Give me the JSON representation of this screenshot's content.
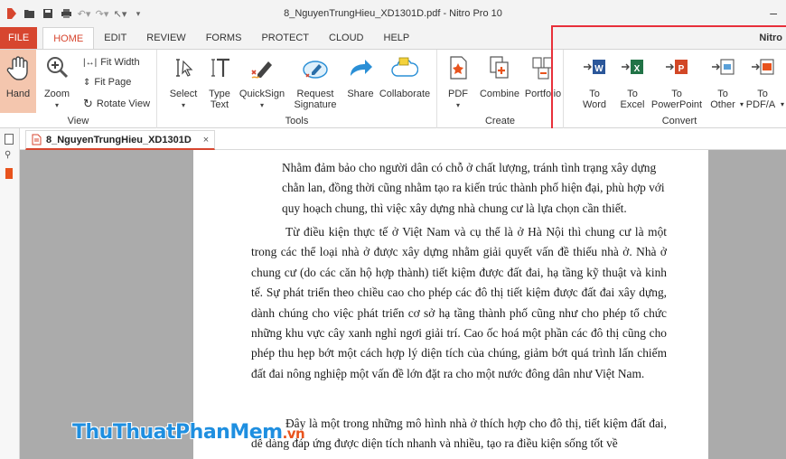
{
  "window": {
    "title": "8_NguyenTrungHieu_XD1301D.pdf - Nitro Pro 10",
    "minimize": "–"
  },
  "tabs": [
    "FILE",
    "HOME",
    "EDIT",
    "REVIEW",
    "FORMS",
    "PROTECT",
    "CLOUD",
    "HELP"
  ],
  "active_tab": "HOME",
  "brand_right": "Nitro",
  "ribbon": {
    "view": {
      "label": "View",
      "hand": "Hand",
      "zoom": "Zoom",
      "fit_width": "Fit Width",
      "fit_page": "Fit Page",
      "rotate_view": "Rotate View"
    },
    "tools": {
      "label": "Tools",
      "select": "Select",
      "type_text_1": "Type",
      "type_text_2": "Text",
      "quicksign": "QuickSign",
      "request_1": "Request",
      "request_2": "Signature",
      "share": "Share",
      "collaborate": "Collaborate"
    },
    "create": {
      "label": "Create",
      "pdf": "PDF",
      "combine": "Combine",
      "portfolio": "Portfolio"
    },
    "convert": {
      "label": "Convert",
      "to_word_1": "To",
      "to_word_2": "Word",
      "to_excel_1": "To",
      "to_excel_2": "Excel",
      "to_ppt_1": "To",
      "to_ppt_2": "PowerPoint",
      "to_other_1": "To",
      "to_other_2": "Other",
      "to_pdfa_1": "To",
      "to_pdfa_2": "PDF/A"
    }
  },
  "document_tab": {
    "name": "8_NguyenTrungHieu_XD1301D",
    "close": "×"
  },
  "document": {
    "para1": "Nhằm đảm bảo cho người dân có chỗ ở chất lượng, tránh tình trạng xây dựng chằn lan, đồng thời cũng nhằm tạo ra kiến trúc thành phố hiện đại, phù hợp với quy hoạch chung, thì việc xây dựng nhà chung cư là lựa chọn cần thiết.",
    "para2": "Từ điều kiện thực tế ở Việt Nam và cụ thể là ở Hà Nội thì chung cư là một trong các thể loại nhà ở được xây dựng nhằm giải quyết vấn đề thiếu nhà ở. Nhà ở chung cư (do các căn hộ hợp thành) tiết kiệm được đất đai, hạ tầng kỹ thuật và kinh tế. Sự phát triển theo chiều cao cho phép các đô thị tiết kiệm được đất đai xây dựng, dành chúng cho việc phát triển cơ sở hạ tầng thành phố cũng như cho phép tổ chức những khu vực cây xanh nghỉ ngơi giải trí. Cao ốc hoá một phần các đô thị cũng cho phép thu hẹp bớt một cách hợp lý diện tích của chúng, giảm bớt quá trình lấn chiếm đất đai nông nghiệp một vấn đề lớn đặt ra cho một nước đông dân như Việt Nam.",
    "para3": "Đây là một trong những mô hình nhà ở thích hợp cho đô thị, tiết kiệm đất đai, dễ dàng đáp ứng được diện tích nhanh và nhiều, tạo ra điều kiện sống tốt về"
  },
  "watermark": {
    "part1": "Thu",
    "part2": "ThuatPhanMem",
    "part3": ".vn"
  },
  "colors": {
    "accent": "#d7462f",
    "highlight_box": "#e8303a",
    "canvas_bg": "#ababab"
  }
}
